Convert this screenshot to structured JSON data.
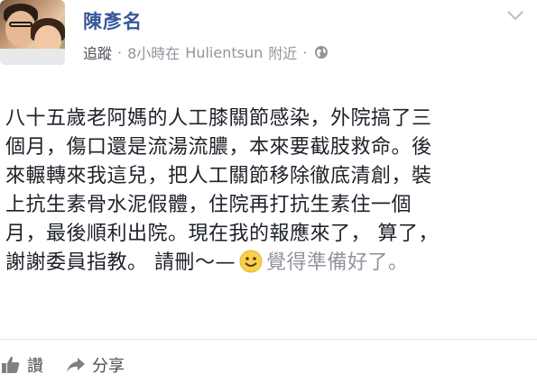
{
  "post": {
    "author": "陳彥名",
    "follow_label": "追蹤",
    "separator": "·",
    "time": "8小時在",
    "location": "Hulientsun",
    "location_suffix": "附近",
    "separator2": "·",
    "audience_icon": "globe-icon",
    "menu_icon": "chevron-down-icon",
    "body_lines": [
      "八十五歲老阿媽的人工膝關節感染，外院搞了三",
      "個月，傷口還是流湯流膿，本來要截肢救命。後",
      "來輾轉來我這兒，把人工關節移除徹底清創，裝",
      "上抗生素骨水泥假體，住院再打抗生素住一個",
      "月，最後順利出院。現在我的報應來了， 算了，"
    ],
    "last_line_text": "謝謝委員指教。 請刪～—",
    "feeling_icon": "smile-icon",
    "feeling_text": "覺得準備好了。"
  },
  "actions": {
    "like_label": "讚",
    "like_icon": "like-icon",
    "share_label": "分享",
    "share_icon": "share-icon"
  },
  "colors": {
    "author": "#365899",
    "meta": "#90949c",
    "text": "#1d2129",
    "feeling_icon": "#f7d14c"
  }
}
